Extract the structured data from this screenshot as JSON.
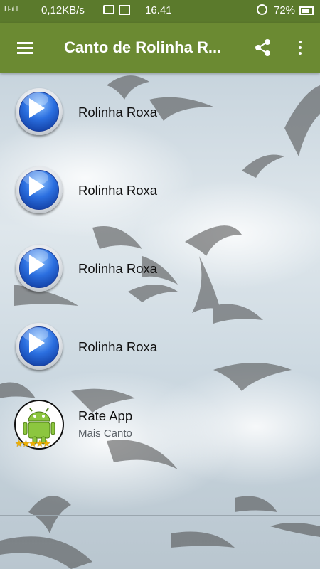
{
  "status_bar": {
    "signal": "H·.ıl ıl",
    "network_speed": "0,12KB/s",
    "time": "16.41",
    "battery": "72%"
  },
  "app_bar": {
    "title": "Canto de Rolinha R...",
    "menu_icon": "hamburger-menu-icon",
    "share_icon": "share-icon",
    "more_icon": "more-vert-icon",
    "color": "#6b8a32"
  },
  "items": [
    {
      "label": "Rolinha Roxa",
      "icon": "play-button-icon"
    },
    {
      "label": "Rolinha Roxa",
      "icon": "play-button-icon"
    },
    {
      "label": "Rolinha Roxa",
      "icon": "play-button-icon"
    },
    {
      "label": "Rolinha Roxa",
      "icon": "play-button-icon"
    }
  ],
  "rate_item": {
    "title": "Rate App",
    "subtitle": "Mais Canto",
    "icon": "android-icon",
    "stars": "★★★★★"
  }
}
